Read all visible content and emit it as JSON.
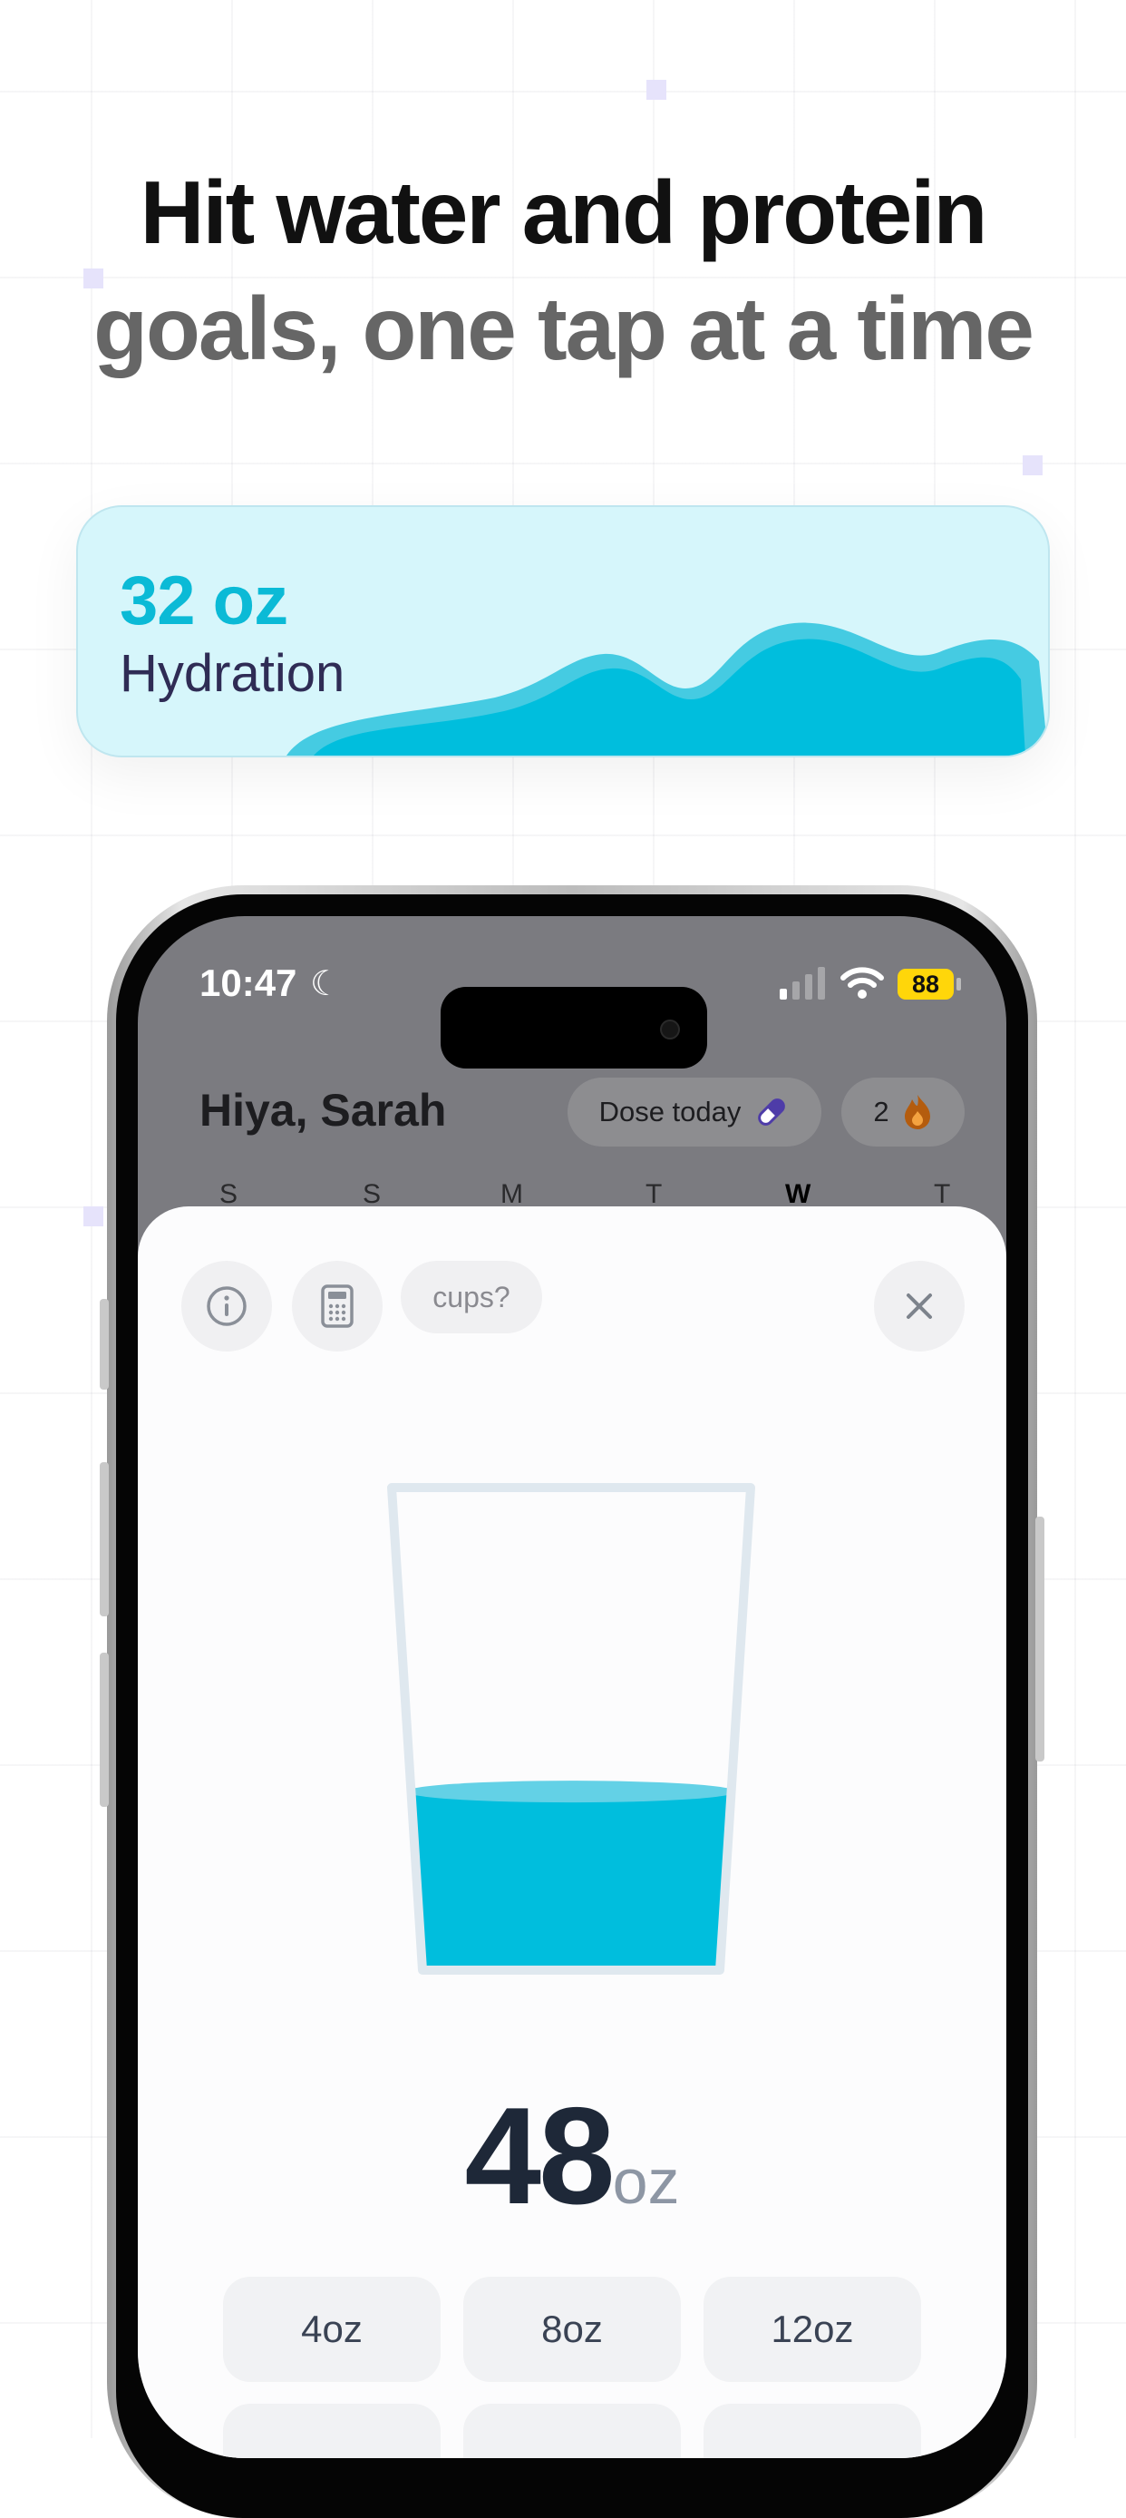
{
  "headline": {
    "line1": "Hit water and protein",
    "line2": "goals, one tap at a time"
  },
  "hydration_card": {
    "value": "32 oz",
    "label": "Hydration",
    "color": "#0bbad6"
  },
  "status_bar": {
    "time": "10:47",
    "battery": "88"
  },
  "header": {
    "greeting": "Hiya, Sarah",
    "dose_label": "Dose today",
    "streak_count": "2"
  },
  "week_days": [
    "S",
    "S",
    "M",
    "T",
    "W",
    "T"
  ],
  "active_day_index": 4,
  "sheet": {
    "cups_label": "cups?",
    "amount": "48",
    "unit": "oz",
    "fill_fraction": 0.37,
    "quick_add": [
      "4oz",
      "8oz",
      "12oz"
    ]
  }
}
